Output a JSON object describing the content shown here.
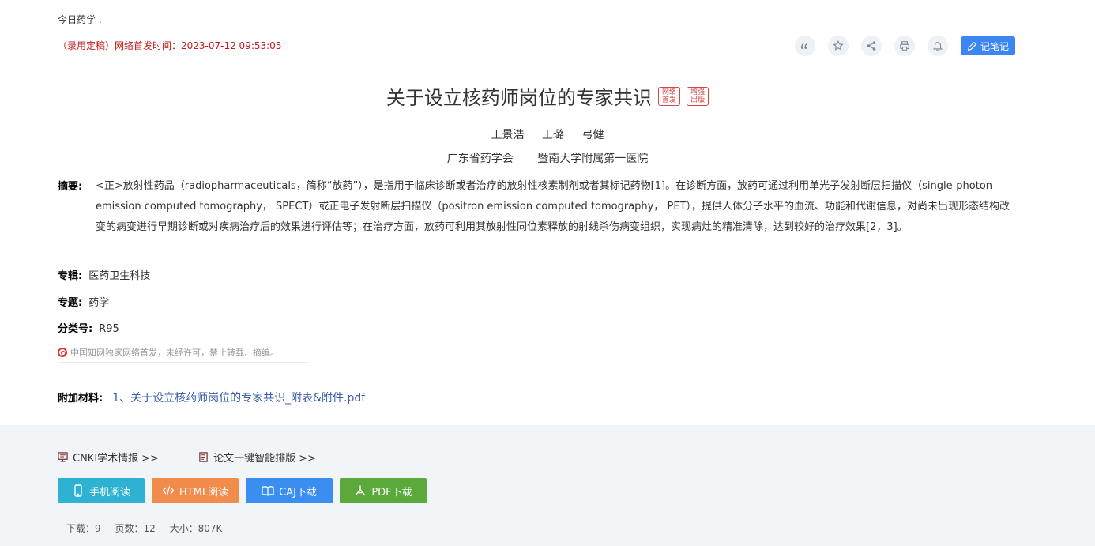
{
  "journal": "今日药学 .",
  "pubtime": "（录用定稿）网络首发时间：2023-07-12 09:53:05",
  "actions": {
    "note_label": "记笔记"
  },
  "title": "关于设立核药师岗位的专家共识",
  "badges": [
    "网络首发",
    "增强出版"
  ],
  "authors": [
    "王景浩",
    "王璐",
    "弓健"
  ],
  "affiliations": [
    "广东省药学会",
    "暨南大学附属第一医院"
  ],
  "abstract": {
    "label": "摘要:",
    "text": "<正>放射性药品（radiopharmaceuticals，简称“放药”），是指用于临床诊断或者治疗的放射性核素制剂或者其标记药物[1]。在诊断方面，放药可通过利用单光子发射断层扫描仪（single-photon emission computed tomography， SPECT）或正电子发射断层扫描仪（positron emission computed tomography， PET），提供人体分子水平的血流、功能和代谢信息，对尚未出现形态结构改变的病变进行早期诊断或对疾病治疗后的效果进行评估等；在治疗方面，放药可利用其放射性同位素释放的射线杀伤病变组织，实现病灶的精准清除，达到较好的治疗效果[2，3]。"
  },
  "meta": [
    {
      "label": "专辑:",
      "value": "医药卫生科技"
    },
    {
      "label": "专题:",
      "value": "药学"
    },
    {
      "label": "分类号:",
      "value": "R95"
    }
  ],
  "copyright": "中国知网独家网络首发，未经许可，禁止转载、摘编。",
  "attachment": {
    "label": "附加材料:",
    "file": "1、关于设立核药师岗位的专家共识_附表&附件.pdf"
  },
  "footer_links": [
    "CNKI学术情报 >>",
    "论文一键智能排版 >>"
  ],
  "buttons": [
    {
      "label": "手机阅读",
      "color": "#2eb1d3"
    },
    {
      "label": "HTML阅读",
      "color": "#f28c4c"
    },
    {
      "label": "CAJ下载",
      "color": "#3a8ef0"
    },
    {
      "label": "PDF下载",
      "color": "#5aa93a"
    }
  ],
  "stats": [
    "下载：9",
    "页数：12",
    "大小：807K"
  ]
}
